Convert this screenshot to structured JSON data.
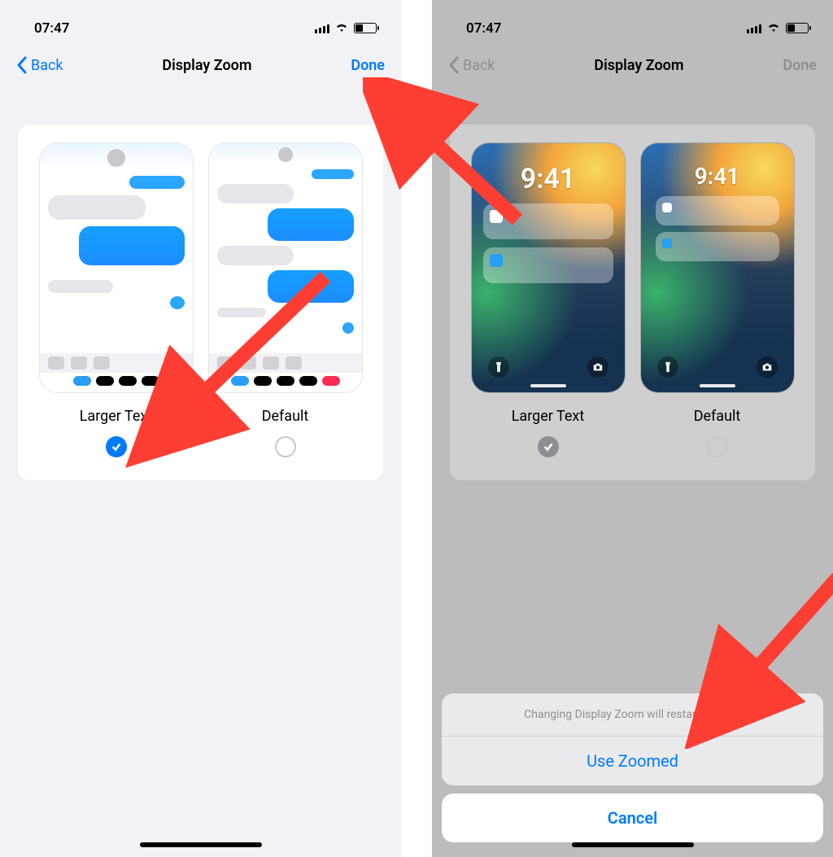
{
  "status": {
    "time": "07:47"
  },
  "nav": {
    "back": "Back",
    "title": "Display Zoom",
    "done": "Done"
  },
  "options": {
    "larger": "Larger Text",
    "default": "Default"
  },
  "preview": {
    "lock_time": "9:41"
  },
  "sheet": {
    "message": "Changing Display Zoom will restart iPhone.",
    "confirm": "Use Zoomed",
    "cancel": "Cancel"
  },
  "colors": {
    "accent": "#007aff",
    "arrow": "#ff3b30"
  }
}
